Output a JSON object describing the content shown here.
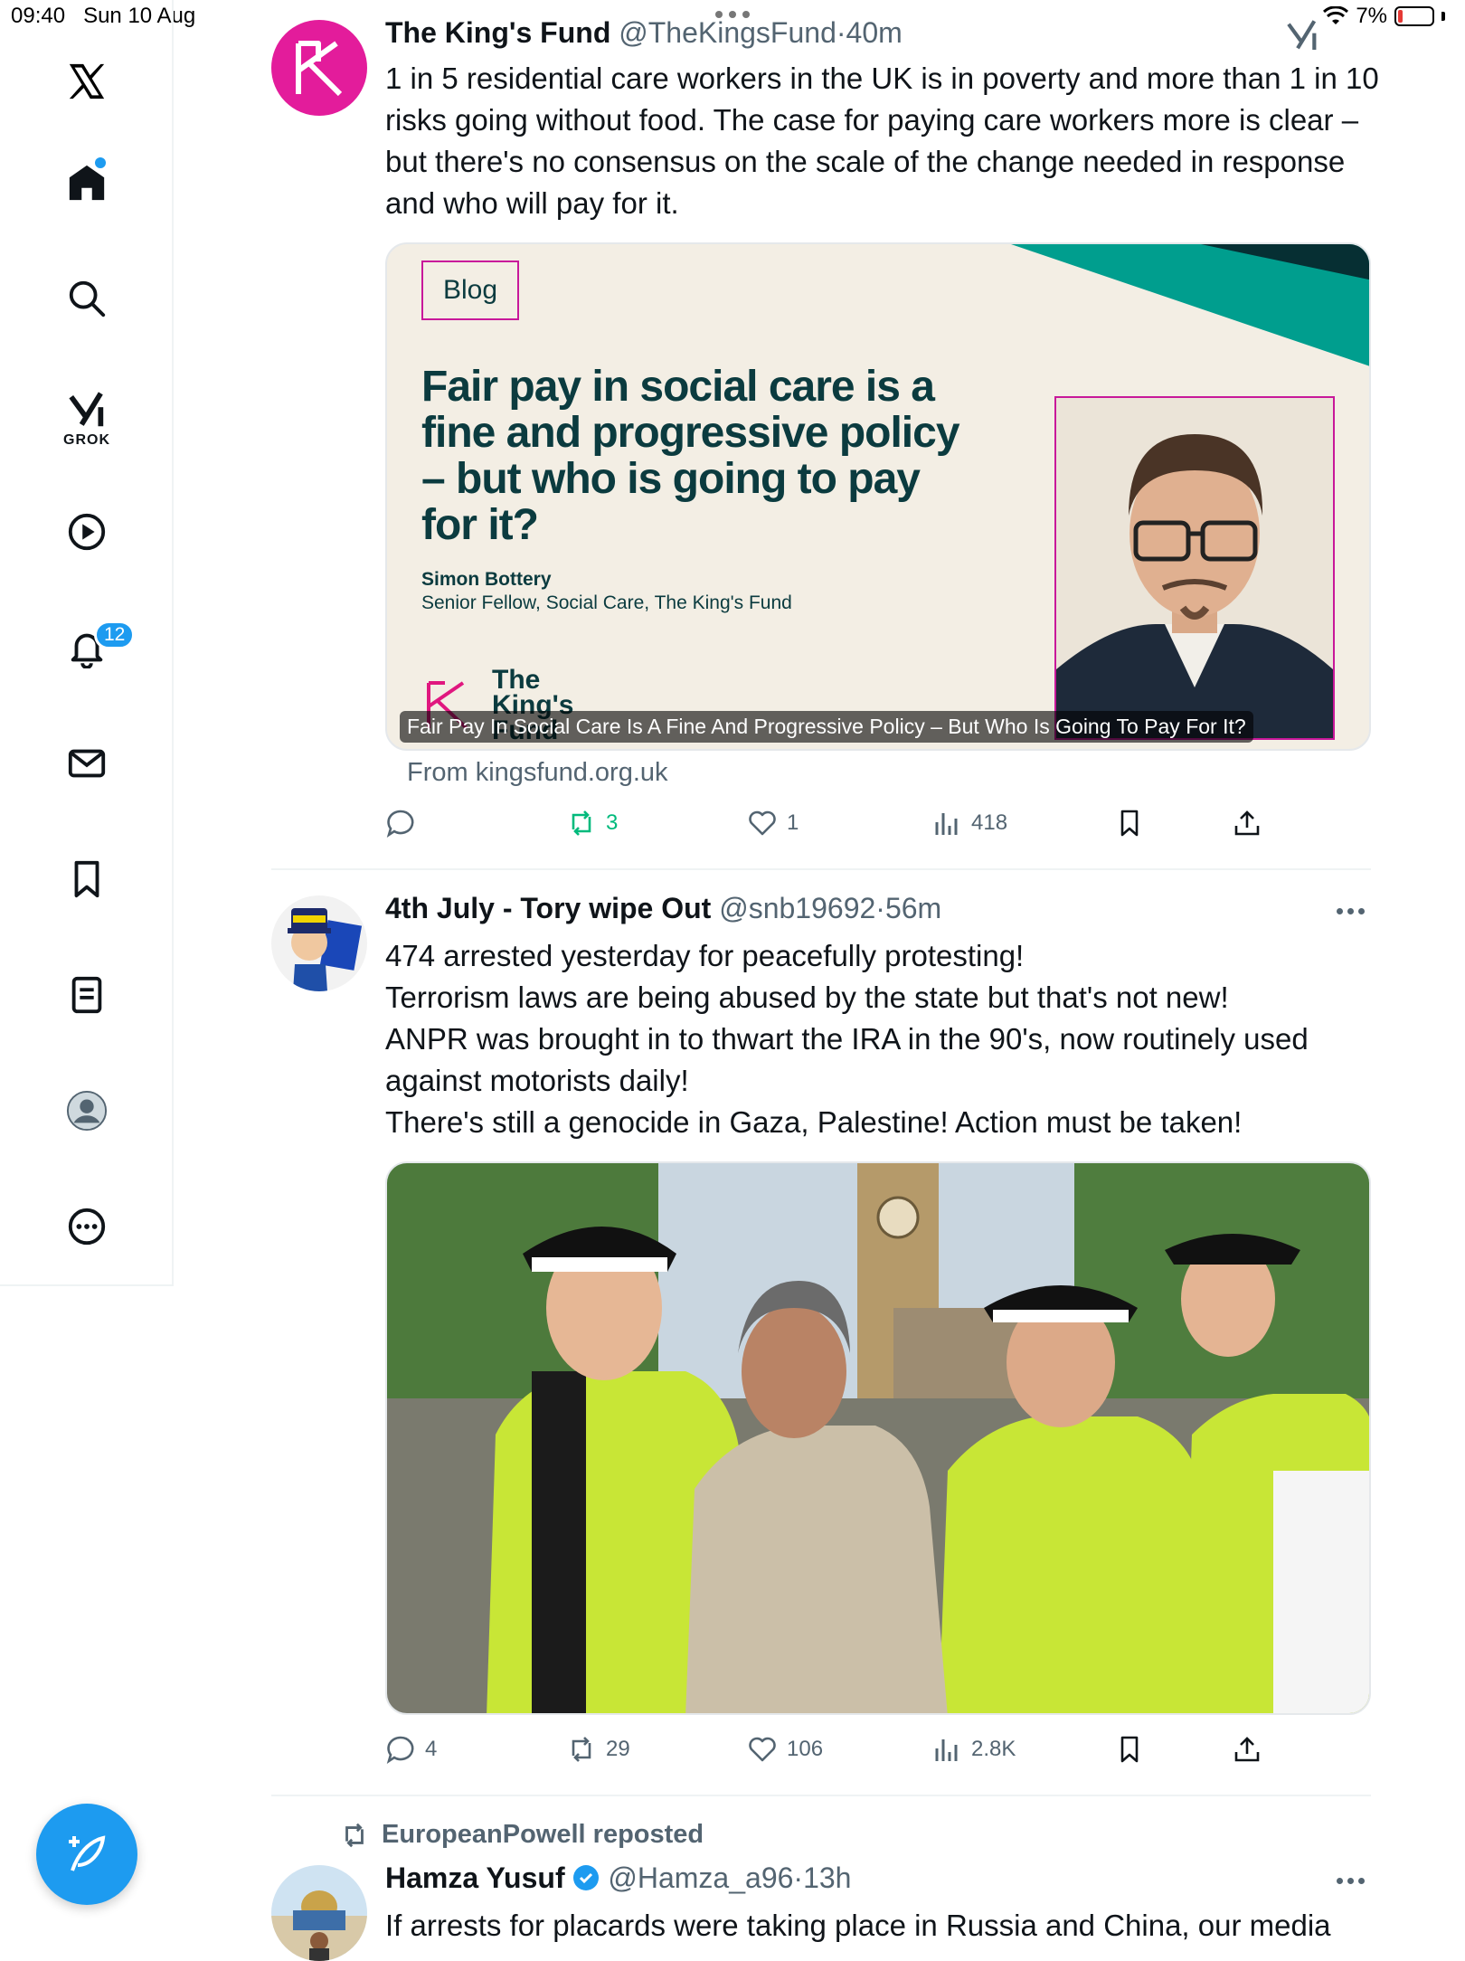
{
  "status_bar": {
    "time": "09:40",
    "date": "Sun 10 Aug",
    "battery": "7%"
  },
  "sidebar": {
    "grok_label": "GROK",
    "notifications_count": "12"
  },
  "tweets": [
    {
      "name": "The King's Fund",
      "handle": "@TheKingsFund",
      "time": "40m",
      "text": "1 in 5 residential care workers in the UK is in poverty and more than 1 in 10 risks going without food. The case for paying care workers more is clear – but there's no consensus on the scale of the change needed in response and who will pay for it.",
      "card": {
        "tag": "Blog",
        "title": "Fair pay in social care is a fine and progressive policy – but who is going to pay for it?",
        "author_name": "Simon Bottery",
        "author_role": "Senior Fellow, Social Care, The King's Fund",
        "logo_text": "The King's Fund",
        "caption": "Fair Pay In Social Care Is A Fine And Progressive Policy – But Who Is Going To Pay For It?",
        "from": "From kingsfund.org.uk"
      },
      "stats": {
        "replies": "",
        "reposts": "3",
        "likes": "1",
        "views": "418"
      }
    },
    {
      "name": "4th July - Tory wipe Out",
      "handle": "@snb19692",
      "time": "56m",
      "lines": [
        "474 arrested yesterday for peacefully protesting!",
        "Terrorism laws are being abused by the state but that's not new!",
        "ANPR was brought in to thwart the IRA in the 90's, now routinely used against motorists daily!",
        "There's still a genocide in Gaza, Palestine! Action must be taken!"
      ],
      "stats": {
        "replies": "4",
        "reposts": "29",
        "likes": "106",
        "views": "2.8K"
      }
    },
    {
      "repost_by": "EuropeanPowell reposted",
      "name": "Hamza Yusuf",
      "handle": "@Hamza_a96",
      "time": "13h",
      "text": "If arrests for placards were taking place in Russia and China, our media"
    }
  ],
  "colors": {
    "accent": "#1d9bf0",
    "repost_green": "#00ba7c",
    "brand_magenta": "#e0177f",
    "teal": "#0b3b3f"
  }
}
